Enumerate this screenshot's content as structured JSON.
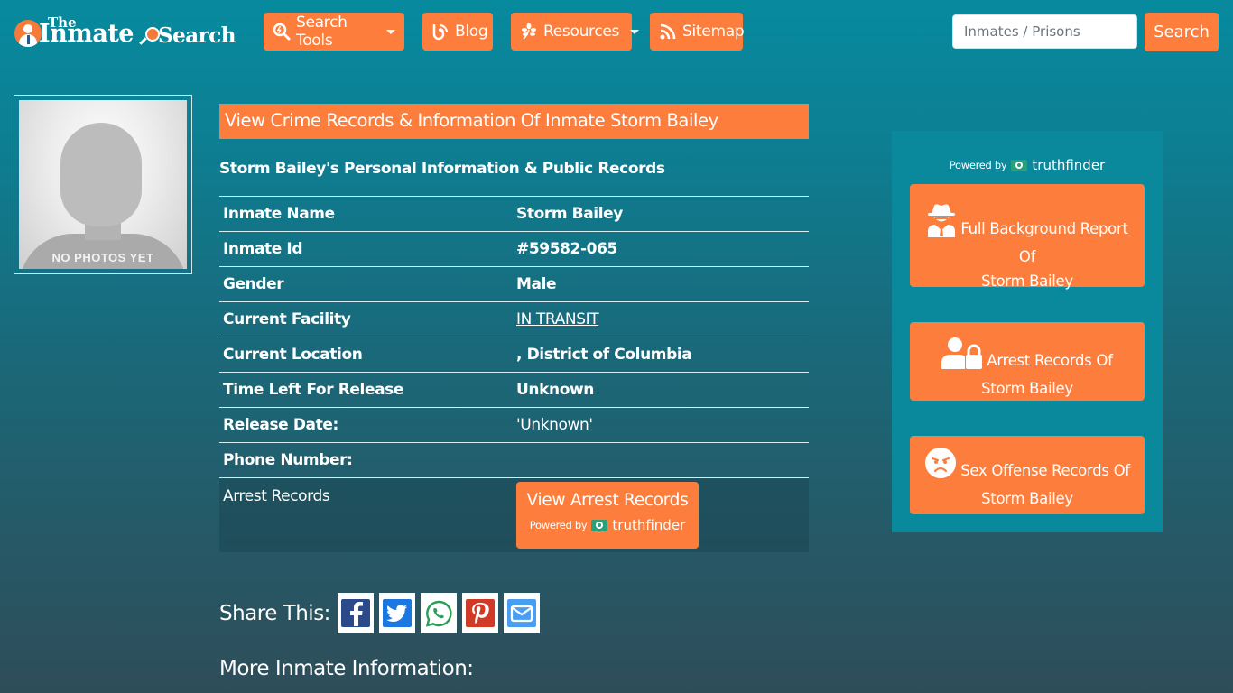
{
  "header": {
    "logo": {
      "the": "The",
      "inmate": "Inmate",
      "search": "Search"
    },
    "nav": [
      {
        "label": "Search Tools",
        "icon": "search-tools-icon",
        "dropdown": true
      },
      {
        "label": "Blog",
        "icon": "blog-icon",
        "dropdown": false
      },
      {
        "label": "Resources",
        "icon": "leaf-icon",
        "dropdown": true
      },
      {
        "label": "Sitemap",
        "icon": "rss-icon",
        "dropdown": false
      }
    ],
    "search": {
      "placeholder": "Inmates / Prisons",
      "value": "",
      "button": "Search"
    }
  },
  "photo": {
    "caption": "NO PHOTOS YET"
  },
  "main": {
    "title": "View Crime Records & Information Of Inmate Storm Bailey",
    "subtitle": "Storm Bailey's Personal Information & Public Records",
    "rows": [
      {
        "label": "Inmate Name",
        "value": "Storm Bailey"
      },
      {
        "label": "Inmate Id",
        "value": "#59582-065"
      },
      {
        "label": "Gender",
        "value": "Male"
      },
      {
        "label": "Current Facility",
        "value": "IN TRANSIT",
        "link": true
      },
      {
        "label": "Current Location",
        "value": ", District of Columbia"
      },
      {
        "label": "Time Left For Release",
        "value": "Unknown"
      },
      {
        "label": "Release Date:",
        "value": "'Unknown'"
      },
      {
        "label": "Phone Number:",
        "value": ""
      }
    ],
    "arrest_row": {
      "label": "Arrest Records",
      "button": "View Arrest Records",
      "powered_by": "Powered by",
      "brand": "truthfinder"
    },
    "share": {
      "label": "Share This:",
      "icons": [
        "facebook-icon",
        "twitter-icon",
        "whatsapp-icon",
        "pinterest-icon",
        "email-icon"
      ]
    },
    "more_info": "More Inmate Information:"
  },
  "side": {
    "powered_by": "Powered by",
    "brand": "truthfinder",
    "buttons": [
      {
        "line1": "Full Background Report",
        "line2": "Of",
        "line3": "Storm Bailey",
        "icon": "spy-icon"
      },
      {
        "line1": "Arrest Records Of",
        "line2": "Storm Bailey",
        "icon": "user-lock-icon"
      },
      {
        "line1": "Sex Offense Records Of",
        "line2": "Storm Bailey",
        "icon": "angry-face-icon"
      }
    ]
  },
  "colors": {
    "accent": "#fd7e3c",
    "bg_top": "#078a9e",
    "bg_bottom": "#2e4d59",
    "panel": "#0a899d"
  }
}
